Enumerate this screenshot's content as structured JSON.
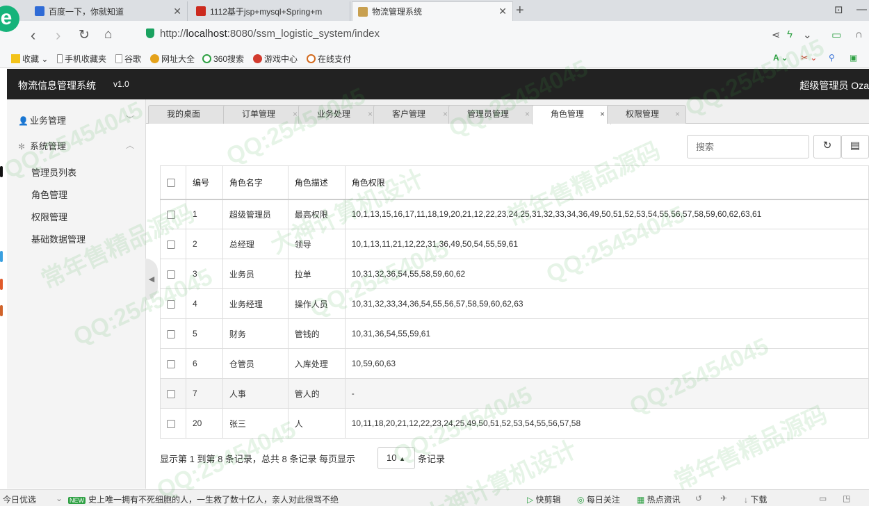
{
  "browser": {
    "tabs": [
      {
        "title": "百度一下，你就知道",
        "color": "#2f6bd6"
      },
      {
        "title": "1112基于jsp+mysql+Spring+m",
        "color": "#cc2a1e"
      },
      {
        "title": "物流管理系统",
        "color": "#c8a050"
      }
    ],
    "url_prefix": "http://",
    "url_host": "localhost",
    "url_rest": ":8080/ssm_logistic_system/index",
    "bookmarks": [
      "收藏",
      "手机收藏夹",
      "谷歌",
      "网址大全",
      "360搜索",
      "游戏中心",
      "在线支付"
    ]
  },
  "app": {
    "title": "物流信息管理系统",
    "version": "v1.0",
    "user": "超级管理员  Oza"
  },
  "sidebar": {
    "groups": [
      {
        "label": "业务管理",
        "icon": "user-icon"
      },
      {
        "label": "系统管理",
        "icon": "gear-icon"
      }
    ],
    "items": [
      "管理员列表",
      "角色管理",
      "权限管理",
      "基础数据管理"
    ]
  },
  "tabs": [
    "我的桌面",
    "订单管理",
    "业务处理",
    "客户管理",
    "管理员管理",
    "角色管理",
    "权限管理"
  ],
  "toolbar": {
    "search_placeholder": "搜索",
    "refresh_icon": "refresh-icon",
    "columns_icon": "columns-icon"
  },
  "table": {
    "headers": [
      "编号",
      "角色名字",
      "角色描述",
      "角色权限"
    ],
    "rows": [
      [
        "1",
        "超级管理员",
        "最高权限",
        "10,1,13,15,16,17,11,18,19,20,21,12,22,23,24,25,31,32,33,34,36,49,50,51,52,53,54,55,56,57,58,59,60,62,63,61"
      ],
      [
        "2",
        "总经理",
        "领导",
        "10,1,13,11,21,12,22,31,36,49,50,54,55,59,61"
      ],
      [
        "3",
        "业务员",
        "拉单",
        "10,31,32,36,54,55,58,59,60,62"
      ],
      [
        "4",
        "业务经理",
        "操作人员",
        "10,31,32,33,34,36,54,55,56,57,58,59,60,62,63"
      ],
      [
        "5",
        "财务",
        "管钱的",
        "10,31,36,54,55,59,61"
      ],
      [
        "6",
        "仓管员",
        "入库处理",
        "10,59,60,63"
      ],
      [
        "7",
        "人事",
        "管人的",
        "-"
      ],
      [
        "20",
        "张三",
        "人",
        "10,11,18,20,21,12,22,23,24,25,49,50,51,52,53,54,55,56,57,58"
      ]
    ]
  },
  "pagination": {
    "summary": "显示第 1 到第 8 条记录，总共 8 条记录  每页显示",
    "page_size": "10",
    "suffix": "条记录"
  },
  "statusbar": {
    "left": "今日优选",
    "news_badge": "NEW",
    "news": "史上唯一拥有不死细胞的人，一生救了数十亿人，亲人对此很骂不绝",
    "right": [
      "快剪辑",
      "每日关注",
      "热点资讯",
      "下载"
    ]
  },
  "watermark": [
    "QQ:25454045",
    "常年售精品源码",
    "大神计算机设计"
  ]
}
